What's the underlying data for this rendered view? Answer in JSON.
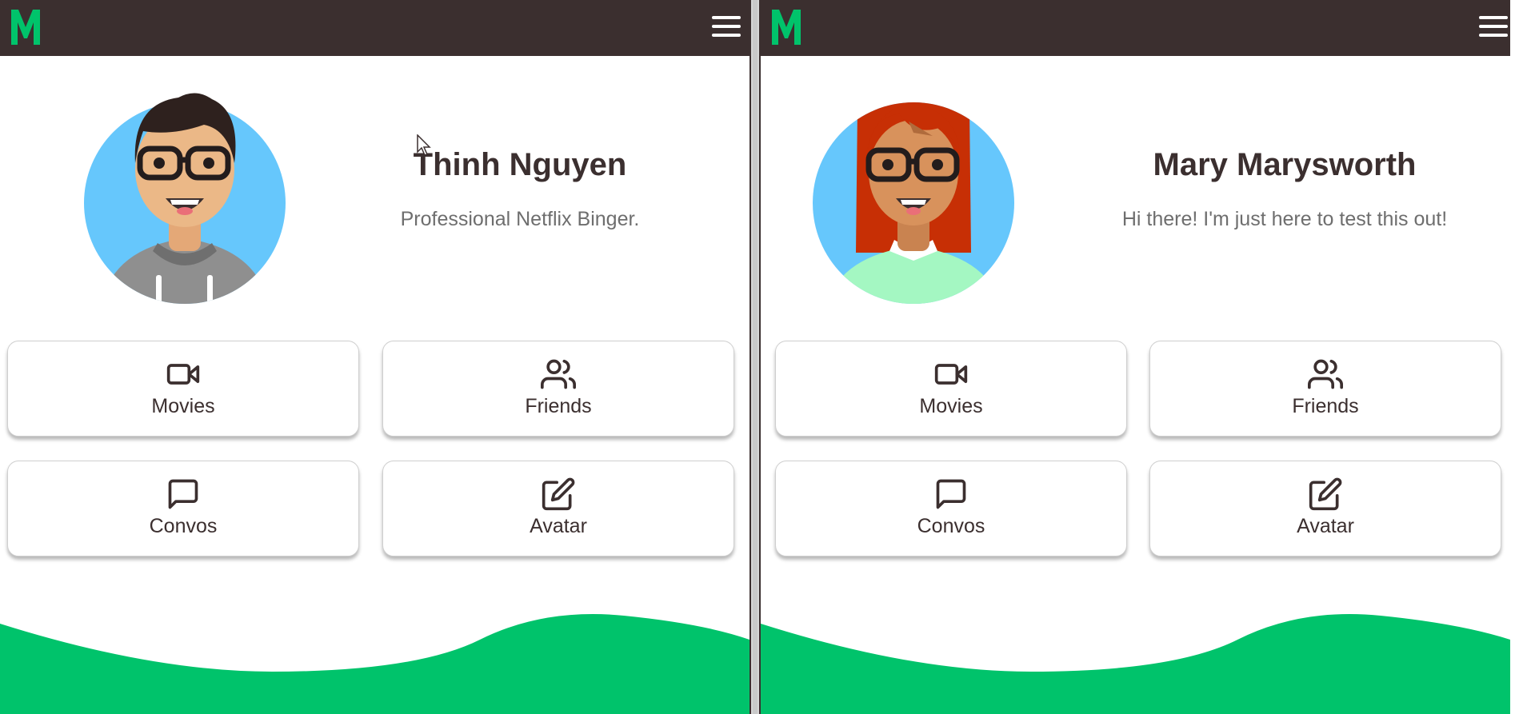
{
  "colors": {
    "topbar": "#3b2f2f",
    "brand_green": "#00c36b",
    "text_dark": "#3b2f2f",
    "text_muted": "#6e6e6e"
  },
  "app": {
    "logo_letter": "M",
    "logo_icon": "m-logo-icon",
    "menu_icon": "hamburger-menu-icon"
  },
  "panes": [
    {
      "profile": {
        "name": "Thinh Nguyen",
        "bio": "Professional Netflix Binger.",
        "avatar_icon": "male-avatar-icon"
      },
      "actions": [
        {
          "label": "Movies",
          "icon": "video-camera-icon"
        },
        {
          "label": "Friends",
          "icon": "users-icon"
        },
        {
          "label": "Convos",
          "icon": "chat-bubble-icon"
        },
        {
          "label": "Avatar",
          "icon": "edit-icon"
        }
      ]
    },
    {
      "profile": {
        "name": "Mary Marysworth",
        "bio": "Hi there! I'm just here to test this out!",
        "avatar_icon": "female-avatar-icon"
      },
      "actions": [
        {
          "label": "Movies",
          "icon": "video-camera-icon"
        },
        {
          "label": "Friends",
          "icon": "users-icon"
        },
        {
          "label": "Convos",
          "icon": "chat-bubble-icon"
        },
        {
          "label": "Avatar",
          "icon": "edit-icon"
        }
      ]
    }
  ]
}
